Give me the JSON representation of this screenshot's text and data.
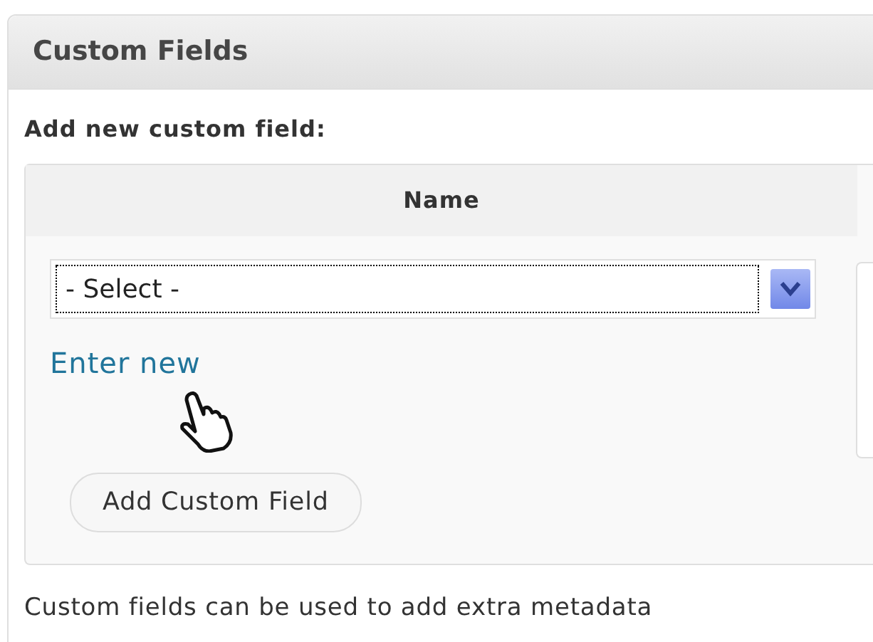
{
  "panel": {
    "title": "Custom Fields"
  },
  "heading": "Add new custom field:",
  "table": {
    "columns": [
      "Name"
    ]
  },
  "name_select": {
    "value": "- Select -"
  },
  "enter_new_link": "Enter new",
  "add_button": "Add Custom Field",
  "description": "Custom fields can be used to add extra metadata"
}
